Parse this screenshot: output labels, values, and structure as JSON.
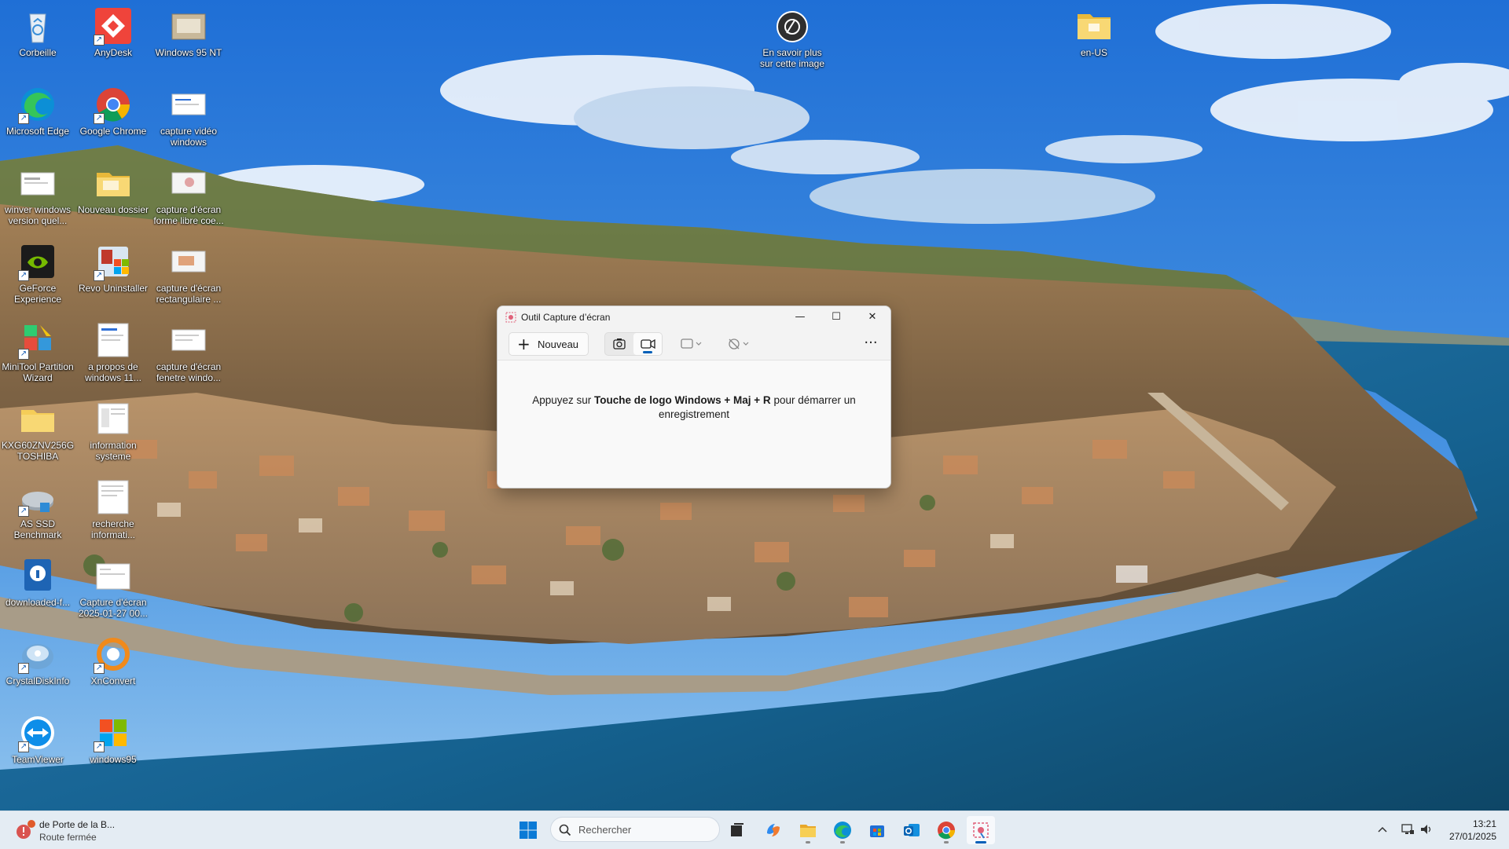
{
  "desktop": {
    "icons": [
      {
        "label": "Corbeille"
      },
      {
        "label": "AnyDesk"
      },
      {
        "label": "Windows 95 NT"
      },
      {
        "label": "En savoir plus sur cette image"
      },
      {
        "label": "en-US"
      },
      {
        "label": "Microsoft Edge"
      },
      {
        "label": "Google Chrome"
      },
      {
        "label": "capture vidéo windows"
      },
      {
        "label": "winver windows version quel..."
      },
      {
        "label": "Nouveau dossier"
      },
      {
        "label": "capture d'écran forme libre coe..."
      },
      {
        "label": "GeForce Experience"
      },
      {
        "label": "Revo Uninstaller"
      },
      {
        "label": "capture d'écran rectangulaire ..."
      },
      {
        "label": "MiniTool Partition Wizard"
      },
      {
        "label": "a propos de windows 11..."
      },
      {
        "label": "capture d'écran fenetre windo..."
      },
      {
        "label": "KXG60ZNV256G TOSHIBA"
      },
      {
        "label": "information systeme"
      },
      {
        "label": "AS SSD Benchmark"
      },
      {
        "label": "recherche informati..."
      },
      {
        "label": "downloaded-f..."
      },
      {
        "label": "Capture d'écran 2025-01-27 00..."
      },
      {
        "label": "CrystalDiskInfo"
      },
      {
        "label": "XnConvert"
      },
      {
        "label": "TeamViewer"
      },
      {
        "label": "windows95"
      }
    ]
  },
  "snipping_tool": {
    "title": "Outil Capture d’écran",
    "new_button": "Nouveau",
    "hint_prefix": "Appuyez sur ",
    "hint_keys": "Touche de logo Windows + Maj + R",
    "hint_suffix": " pour démarrer un enregistrement",
    "active_mode": "video",
    "window_buttons": {
      "minimize": "—",
      "maximize": "☐",
      "close": "✕"
    },
    "more": "···"
  },
  "taskbar": {
    "weather_line1": "de Porte de la B...",
    "weather_line2": "Route fermée",
    "search_placeholder": "Rechercher",
    "time": "13:21",
    "date": "27/01/2025",
    "apps": [
      "start-icon",
      "task-view-icon",
      "copilot-icon",
      "file-explorer-icon",
      "edge-icon",
      "store-icon",
      "outlook-icon",
      "chrome-icon",
      "snipping-tool-icon"
    ],
    "active_app": "snipping-tool-icon"
  },
  "colors": {
    "accent": "#005fb8",
    "taskbar_bg": "#e4ecf3",
    "window_bg": "#f3f3f3"
  }
}
